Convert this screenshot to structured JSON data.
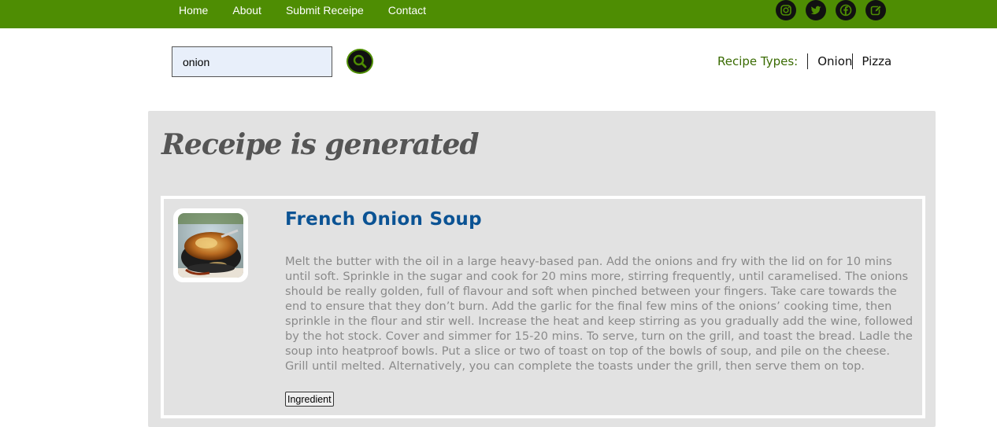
{
  "nav": {
    "links": [
      "Home",
      "About",
      "Submit Receipe",
      "Contact"
    ]
  },
  "socials": [
    "instagram-icon",
    "twitter-icon",
    "facebook-icon",
    "edit-icon"
  ],
  "search": {
    "value": "onion",
    "placeholder": ""
  },
  "recipe_types": {
    "label": "Recipe Types:",
    "items": [
      "Onion",
      "Pizza"
    ]
  },
  "panel": {
    "title": "Receipe is generated"
  },
  "recipe": {
    "title": "French Onion Soup",
    "description": "Melt the butter with the oil in a large heavy-based pan. Add the onions and fry with the lid on for 10 mins until soft. Sprinkle in the sugar and cook for 20 mins more, stirring frequently, until caramelised. The onions should be really golden, full of flavour and soft when pinched between your fingers. Take care towards the end to ensure that they don’t burn. Add the garlic for the final few mins of the onions’ cooking time, then sprinkle in the flour and stir well. Increase the heat and keep stirring as you gradually add the wine, followed by the hot stock. Cover and simmer for 15-20 mins. To serve, turn on the grill, and toast the bread. Ladle the soup into heatproof bowls. Put a slice or two of toast on top of the bowls of soup, and pile on the cheese. Grill until melted. Alternatively, you can complete the toasts under the grill, then serve them on top.",
    "button_label": "Ingredient"
  },
  "colors": {
    "nav_green": "#4e8d03",
    "title_blue": "#0b5394",
    "panel_gray": "#e2e2e2"
  }
}
